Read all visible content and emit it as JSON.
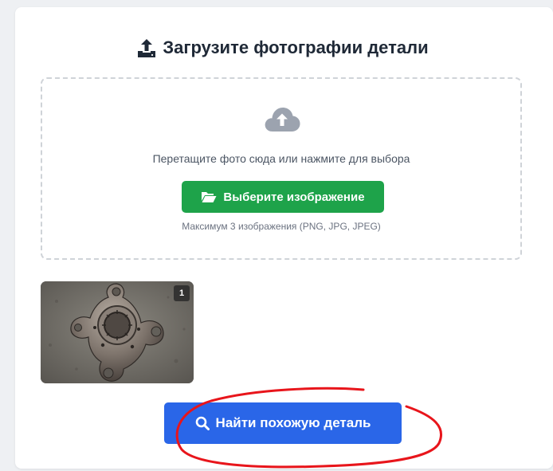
{
  "upload": {
    "title": "Загрузите фотографии детали",
    "dropzone_text": "Перетащите фото сюда или нажмите для выбора",
    "choose_button": "Выберите изображение",
    "hint": "Максимум 3 изображения (PNG, JPG, JPEG)"
  },
  "thumbnails": [
    {
      "index_label": "1"
    }
  ],
  "find_button": "Найти похожую деталь",
  "colors": {
    "choose_button": "#1ea34a",
    "find_button": "#2a66e8",
    "annotation": "#e8151b"
  },
  "icons": {
    "title": "upload-icon",
    "dropzone": "cloud-upload-icon",
    "choose": "folder-open-icon",
    "find": "search-icon"
  }
}
